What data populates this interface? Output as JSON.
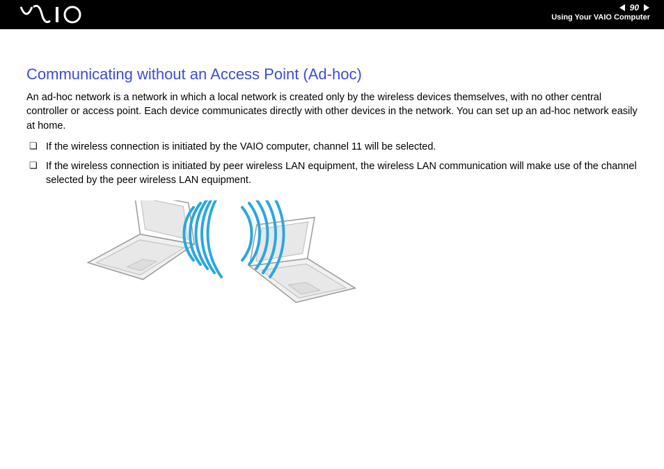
{
  "header": {
    "logo_text": "VAIO",
    "page_number": "90",
    "section": "Using Your VAIO Computer"
  },
  "page": {
    "title": "Communicating without an Access Point (Ad-hoc)",
    "intro": "An ad-hoc network is a network in which a local network is created only by the wireless devices themselves, with no other central controller or access point. Each device communicates directly with other devices in the network. You can set up an ad-hoc network easily at home.",
    "bullets": [
      "If the wireless connection is initiated by the VAIO computer, channel 11 will be selected.",
      "If the wireless connection is initiated by peer wireless LAN equipment, the wireless LAN communication will make use of the channel selected by the peer wireless LAN equipment."
    ]
  }
}
